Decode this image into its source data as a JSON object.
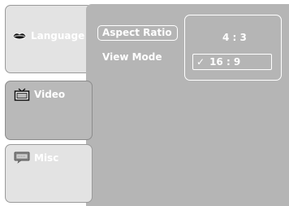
{
  "tabs": [
    {
      "label": "Language",
      "icon": "lips-icon"
    },
    {
      "label": "Video",
      "icon": "tv-icon"
    },
    {
      "label": "Misc",
      "icon": "misc-icon"
    }
  ],
  "active_tab": "Video",
  "panel": {
    "items": [
      {
        "label": "Aspect Ratio"
      },
      {
        "label": "View Mode"
      }
    ],
    "selected_item": "Aspect Ratio"
  },
  "dropdown": {
    "options": [
      {
        "label": "4 : 3"
      },
      {
        "label": "16 : 9",
        "check": "✓"
      }
    ],
    "selected": "16 : 9"
  },
  "colors": {
    "panel_bg": "#b5b5b5",
    "inactive_tab_bg": "#e3e3e3",
    "active_tab_bg": "#b9b9b9",
    "text": "#ffffff"
  }
}
